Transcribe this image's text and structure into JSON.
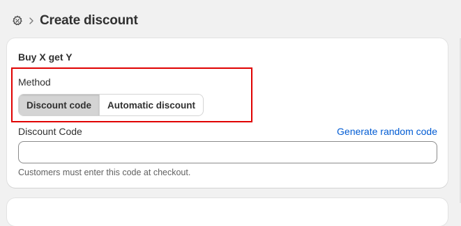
{
  "header": {
    "title": "Create discount",
    "icons": [
      "discount-gear-icon",
      "chevron-right-icon"
    ]
  },
  "card": {
    "title": "Buy X get Y",
    "method": {
      "label": "Method",
      "options": [
        "Discount code",
        "Automatic discount"
      ],
      "selected": "Discount code"
    },
    "discount_code": {
      "label": "Discount Code",
      "generate_link": "Generate random code",
      "value": "",
      "placeholder": "",
      "help_text": "Customers must enter this code at checkout."
    }
  },
  "colors": {
    "background": "#f1f1f1",
    "card": "#ffffff",
    "link": "#005bd3",
    "highlight_box": "#e00000",
    "selected_segment": "#d4d4d4"
  }
}
